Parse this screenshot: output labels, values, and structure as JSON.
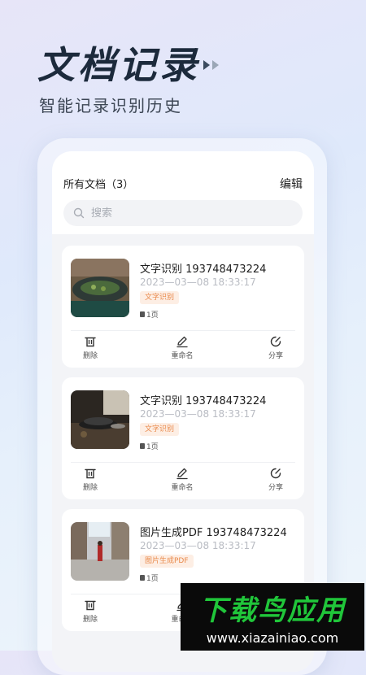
{
  "hero": {
    "title": "文档记录",
    "subtitle": "智能记录识别历史"
  },
  "header": {
    "all_docs": "所有文档（3）",
    "edit": "编辑"
  },
  "search": {
    "placeholder": "搜索"
  },
  "documents": [
    {
      "title": "文字识别 193748473224",
      "date": "2023—03—08 18:33:17",
      "tag": "文字识别",
      "pages": "1页"
    },
    {
      "title": "文字识别 193748473224",
      "date": "2023—03—08 18:33:17",
      "tag": "文字识别",
      "pages": "1页"
    },
    {
      "title": "图片生成PDF 193748473224",
      "date": "2023—03—08 18:33:17",
      "tag": "图片生成PDF",
      "pages": "1页"
    }
  ],
  "actions": {
    "delete": "删除",
    "rename": "重命名",
    "share": "分享"
  },
  "watermark": {
    "brand": "下载鸟应用",
    "url": "www.xiazainiao.com"
  },
  "colors": {
    "tag_bg": "#fdeee4",
    "tag_text": "#e98a4c",
    "watermark_green": "#20c63a"
  }
}
